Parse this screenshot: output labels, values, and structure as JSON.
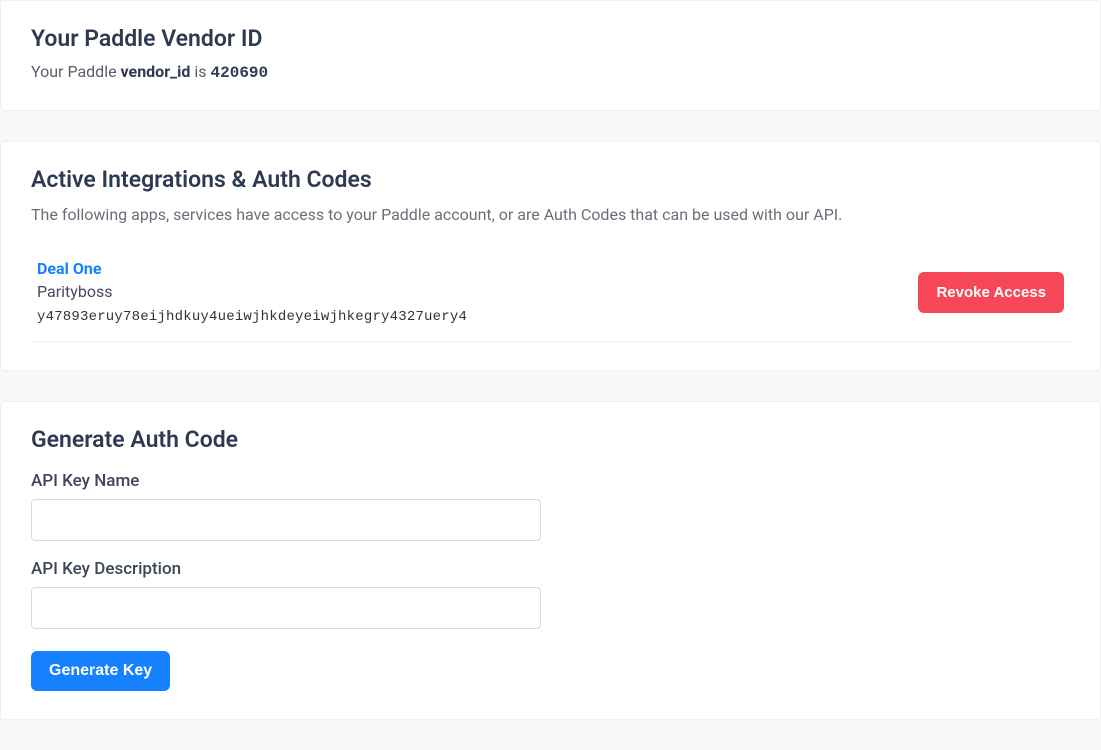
{
  "vendor": {
    "title": "Your Paddle Vendor ID",
    "line_prefix": "Your Paddle ",
    "line_strong": "vendor_id",
    "line_mid": " is ",
    "id": "420690"
  },
  "integrations": {
    "title": "Active Integrations & Auth Codes",
    "subtitle": "The following apps, services have access to your Paddle account, or are Auth Codes that can be used with our API.",
    "items": [
      {
        "name": "Deal One",
        "subname": "Parityboss",
        "code": "y47893eruy78eijhdkuy4ueiwjhkdeyeiwjhkegry4327uery4",
        "revoke_label": "Revoke Access"
      }
    ]
  },
  "generate": {
    "title": "Generate Auth Code",
    "name_label": "API Key Name",
    "desc_label": "API Key Description",
    "button_label": "Generate Key"
  }
}
